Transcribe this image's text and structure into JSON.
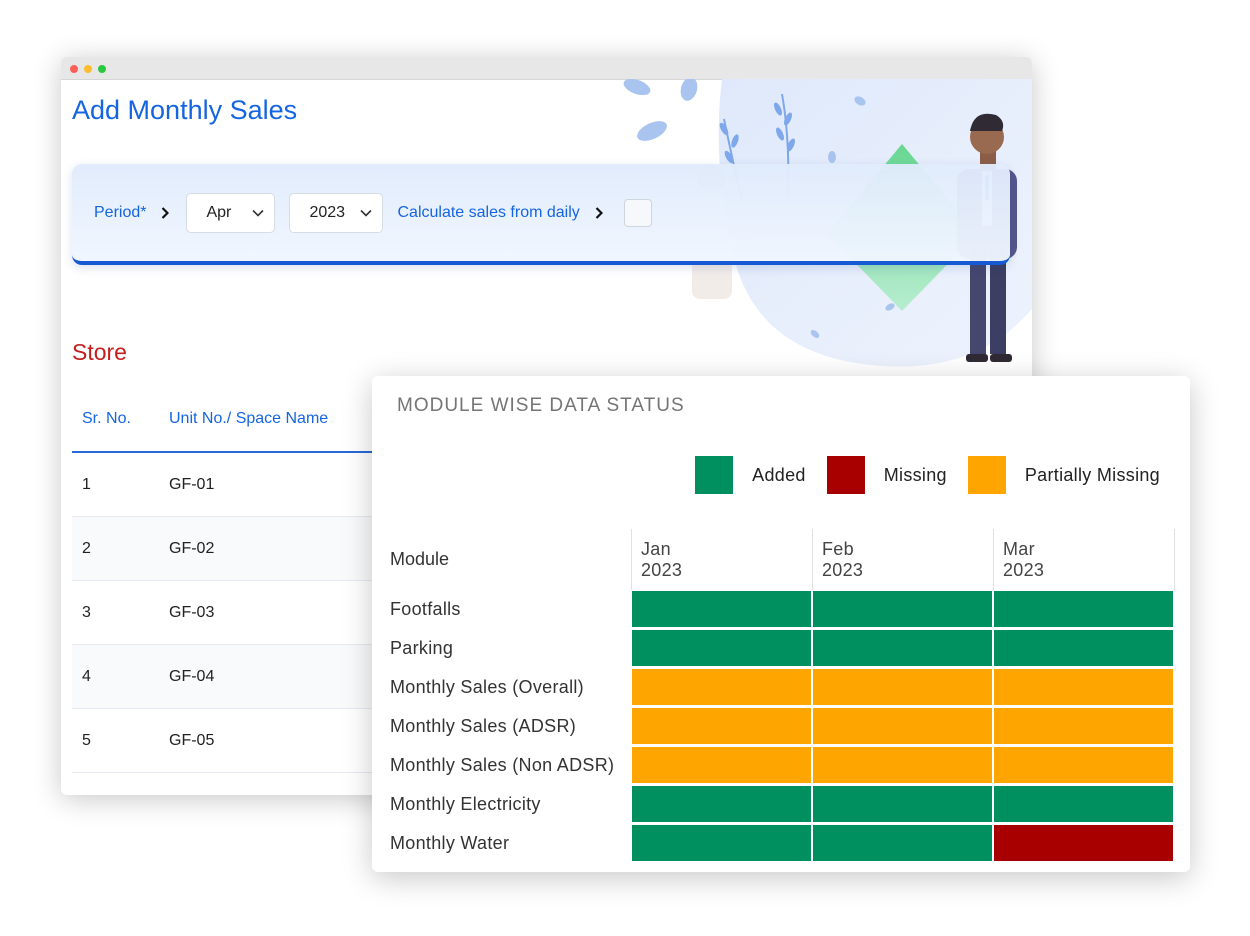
{
  "page": {
    "title": "Add Monthly Sales"
  },
  "filters": {
    "period_label": "Period*",
    "month_value": "Apr",
    "year_value": "2023",
    "calc_label": "Calculate sales from daily"
  },
  "store": {
    "title": "Store",
    "columns": [
      "Sr. No.",
      "Unit No./ Space Name"
    ],
    "rows": [
      {
        "sr": "1",
        "unit": "GF-01"
      },
      {
        "sr": "2",
        "unit": "GF-02"
      },
      {
        "sr": "3",
        "unit": "GF-03"
      },
      {
        "sr": "4",
        "unit": "GF-04"
      },
      {
        "sr": "5",
        "unit": "GF-05"
      }
    ]
  },
  "status_panel": {
    "title": "MODULE WISE DATA STATUS",
    "legend": [
      {
        "label": "Added",
        "color": "#008f5e"
      },
      {
        "label": "Missing",
        "color": "#a80000"
      },
      {
        "label": "Partially Missing",
        "color": "#ffa500"
      }
    ],
    "module_header": "Module",
    "months": [
      {
        "month": "Jan",
        "year": "2023"
      },
      {
        "month": "Feb",
        "year": "2023"
      },
      {
        "month": "Mar",
        "year": "2023"
      }
    ],
    "rows": [
      {
        "module": "Footfalls",
        "status": [
          "added",
          "added",
          "added"
        ]
      },
      {
        "module": "Parking",
        "status": [
          "added",
          "added",
          "added"
        ]
      },
      {
        "module": "Monthly Sales (Overall)",
        "status": [
          "partial",
          "partial",
          "partial"
        ]
      },
      {
        "module": "Monthly Sales (ADSR)",
        "status": [
          "partial",
          "partial",
          "partial"
        ]
      },
      {
        "module": "Monthly Sales (Non ADSR)",
        "status": [
          "partial",
          "partial",
          "partial"
        ]
      },
      {
        "module": "Monthly Electricity",
        "status": [
          "added",
          "added",
          "added"
        ]
      },
      {
        "module": "Monthly Water",
        "status": [
          "added",
          "added",
          "missing"
        ]
      }
    ]
  },
  "colors": {
    "added": "#008f5e",
    "missing": "#a80000",
    "partial": "#ffa500",
    "accent": "#1565e0",
    "store_title": "#c41e1e"
  }
}
